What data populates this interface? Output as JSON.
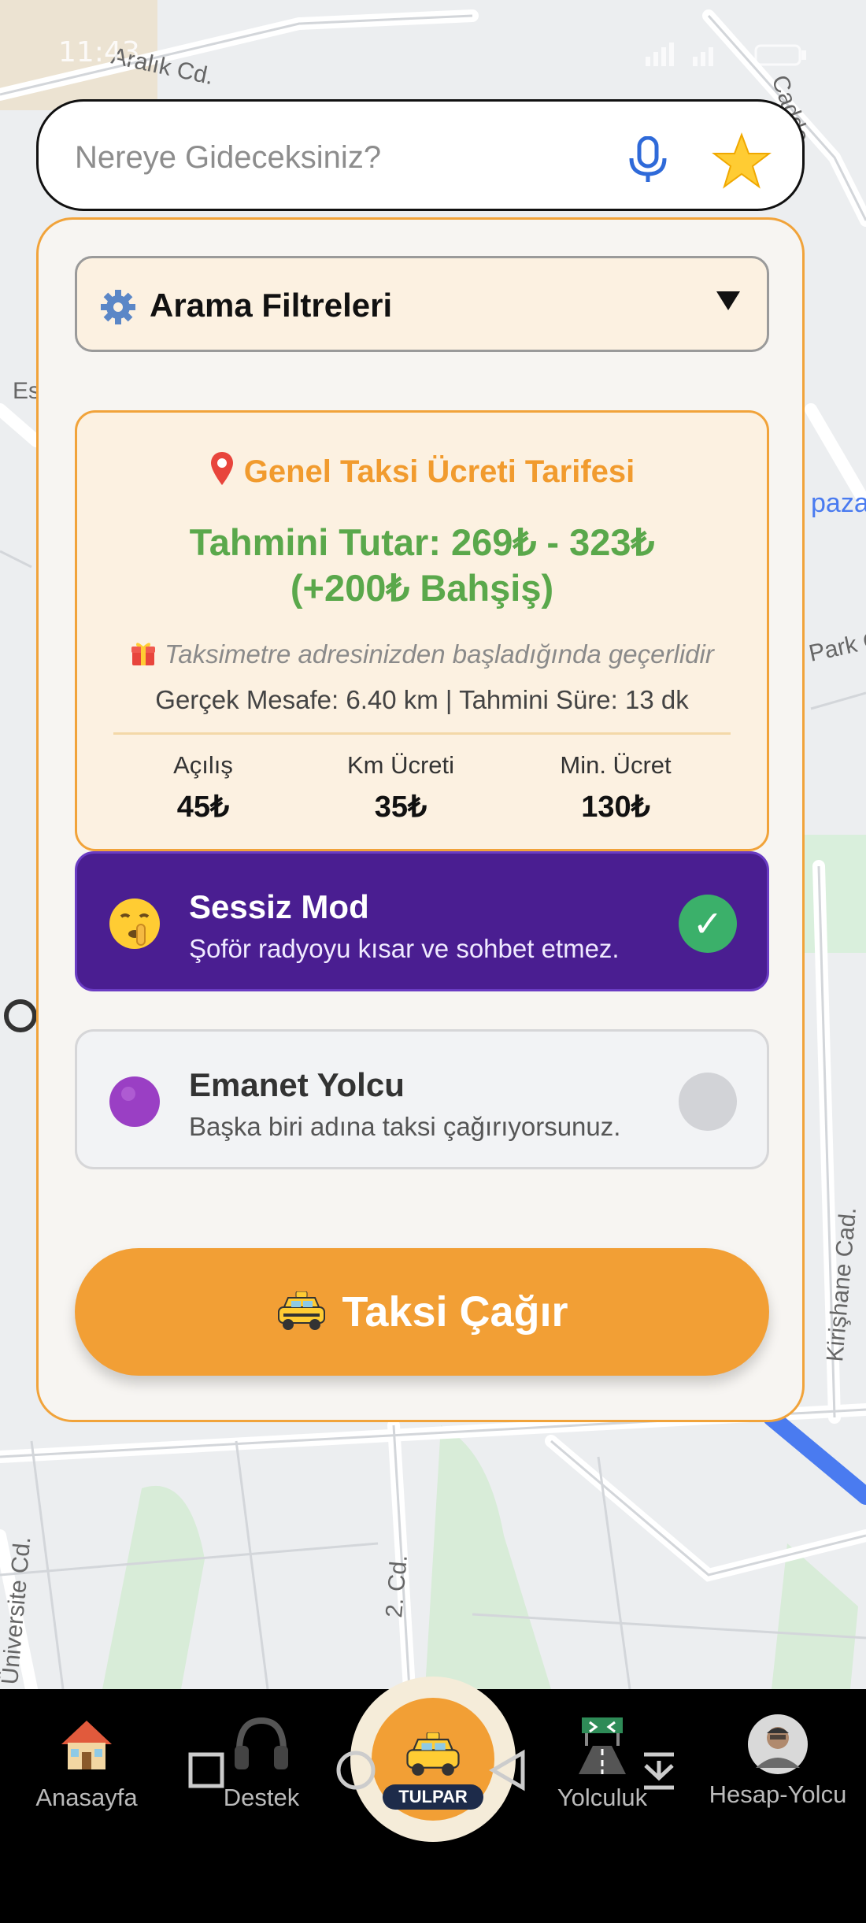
{
  "status": {
    "time": "11:43"
  },
  "map": {
    "street_labels": [
      "Aralık Cd.",
      "Cadde",
      "Es",
      "pazar",
      "Park Cd",
      "Kirişhane Cad.",
      "2. Cd.",
      "Üniversite Cd."
    ],
    "route_color": "#4a7bf0"
  },
  "search": {
    "placeholder": "Nereye Gideceksiniz?",
    "mic_icon": "microphone-icon",
    "favorite_icon": "star-icon"
  },
  "filters": {
    "label": "Arama Filtreleri",
    "icon": "gear-icon"
  },
  "tariff": {
    "title": "Genel Taksi Ücreti Tarifesi",
    "amount_line1": "Tahmini Tutar: 269₺ - 323₺",
    "amount_line2": "(+200₺ Bahşiş)",
    "note": "Taksimetre adresinizden başladığında geçerlidir",
    "distance": "Gerçek Mesafe: 6.40 km | Tahmini Süre: 13 dk",
    "columns": [
      {
        "label": "Açılış",
        "value": "45₺"
      },
      {
        "label": "Km Ücreti",
        "value": "35₺"
      },
      {
        "label": "Min. Ücret",
        "value": "130₺"
      }
    ]
  },
  "options": [
    {
      "title": "Sessiz Mod",
      "subtitle": "Şoför radyoyu kısar ve sohbet etmez.",
      "checked": true,
      "check_mark": "✓"
    },
    {
      "title": "Emanet Yolcu",
      "subtitle": "Başka biri adına taksi çağırıyorsunuz.",
      "checked": false
    }
  ],
  "call_button": {
    "label": "Taksi Çağır"
  },
  "colors": {
    "accent": "#f29f35",
    "silent_bg": "#4a1e91",
    "success": "#3bb06a",
    "amount": "#5aa84b"
  },
  "nav": {
    "items": [
      {
        "label": "Anasayfa",
        "icon": "house-icon"
      },
      {
        "label": "Destek",
        "icon": "headphones-icon"
      },
      {
        "label": "Yolculuk",
        "icon": "road-icon"
      },
      {
        "label": "Hesap-Yolcu",
        "icon": "avatar"
      }
    ],
    "center_badge": "TULPAR"
  }
}
